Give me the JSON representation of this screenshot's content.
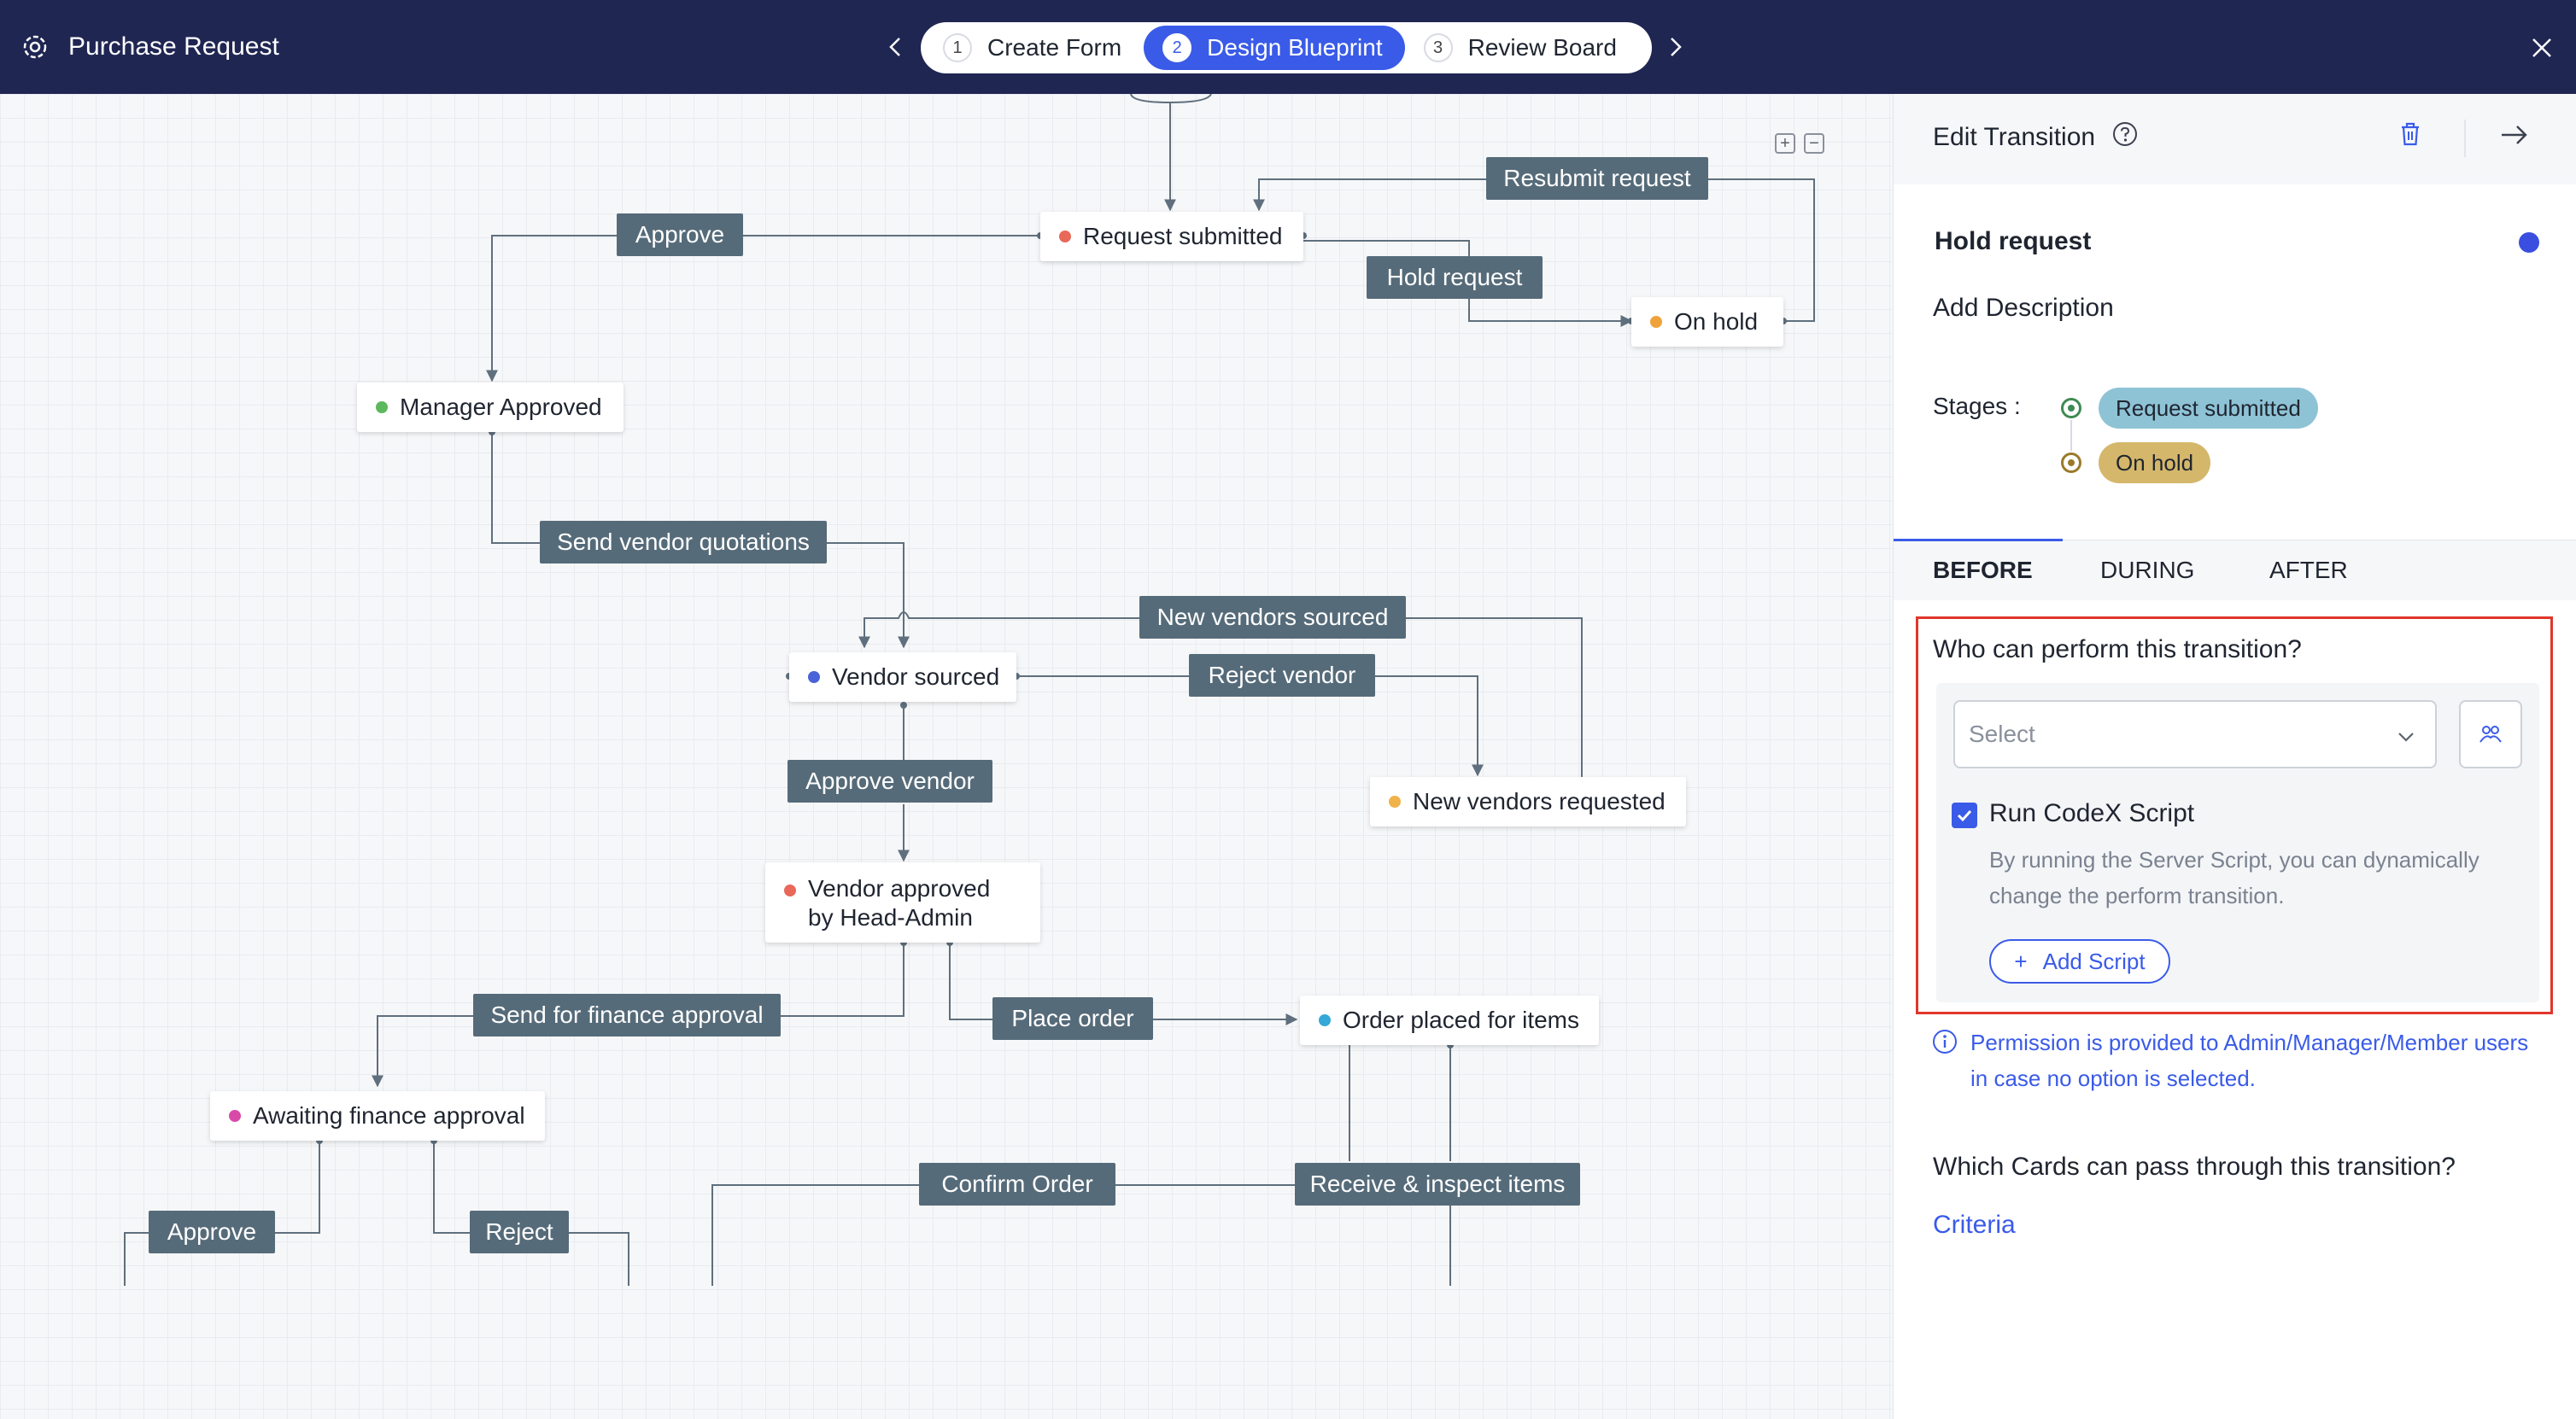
{
  "header": {
    "title": "Purchase Request",
    "steps": [
      {
        "num": "1",
        "label": "Create Form"
      },
      {
        "num": "2",
        "label": "Design Blueprint"
      },
      {
        "num": "3",
        "label": "Review Board"
      }
    ],
    "active_step": 2
  },
  "blueprint": {
    "stages": {
      "request_submitted": {
        "label": "Request submitted",
        "color": "#e8685a"
      },
      "on_hold": {
        "label": "On hold",
        "color": "#f0a23a"
      },
      "manager_approved": {
        "label": "Manager Approved",
        "color": "#5cb85c"
      },
      "vendor_sourced": {
        "label": "Vendor sourced",
        "color": "#4a62d8"
      },
      "new_vendors_requested": {
        "label": "New vendors requested",
        "color": "#f0b34a"
      },
      "vendor_approved": {
        "label": "Vendor approved by Head-Admin",
        "color": "#e8685a"
      },
      "order_placed": {
        "label": "Order placed for items",
        "color": "#35a7d8"
      },
      "awaiting_finance": {
        "label": "Awaiting finance approval",
        "color": "#d84aa8"
      }
    },
    "transitions": {
      "resubmit_request": "Resubmit request",
      "approve": "Approve",
      "hold_request": "Hold request",
      "send_vendor_quotations": "Send vendor quotations",
      "new_vendors_sourced": "New vendors sourced",
      "reject_vendor": "Reject vendor",
      "approve_vendor": "Approve vendor",
      "send_for_finance_approval": "Send for finance approval",
      "place_order": "Place order",
      "confirm_order": "Confirm Order",
      "receive_inspect_items": "Receive & inspect items",
      "approve_finance": "Approve",
      "reject": "Reject"
    }
  },
  "panel": {
    "title": "Edit Transition",
    "transition_name": "Hold request",
    "transition_color": "#3a4fe0",
    "add_description": "Add Description",
    "stages_label": "Stages :",
    "from_stage": {
      "label": "Request submitted",
      "bg": "#8ec3d6"
    },
    "to_stage": {
      "label": "On hold",
      "bg": "#d4b76a"
    },
    "tabs": [
      "BEFORE",
      "DURING",
      "AFTER"
    ],
    "active_tab": "BEFORE",
    "who_question": "Who can perform this transition?",
    "select_placeholder": "Select",
    "run_script_label": "Run CodeX Script",
    "run_script_checked": true,
    "run_script_help": "By running the Server Script, you can dynamically change the perform transition.",
    "add_script_label": "Add Script",
    "permission_note": "Permission is provided to Admin/Manager/Member users in case no option is selected.",
    "cards_question": "Which Cards can pass through this transition?",
    "criteria_label": "Criteria"
  }
}
